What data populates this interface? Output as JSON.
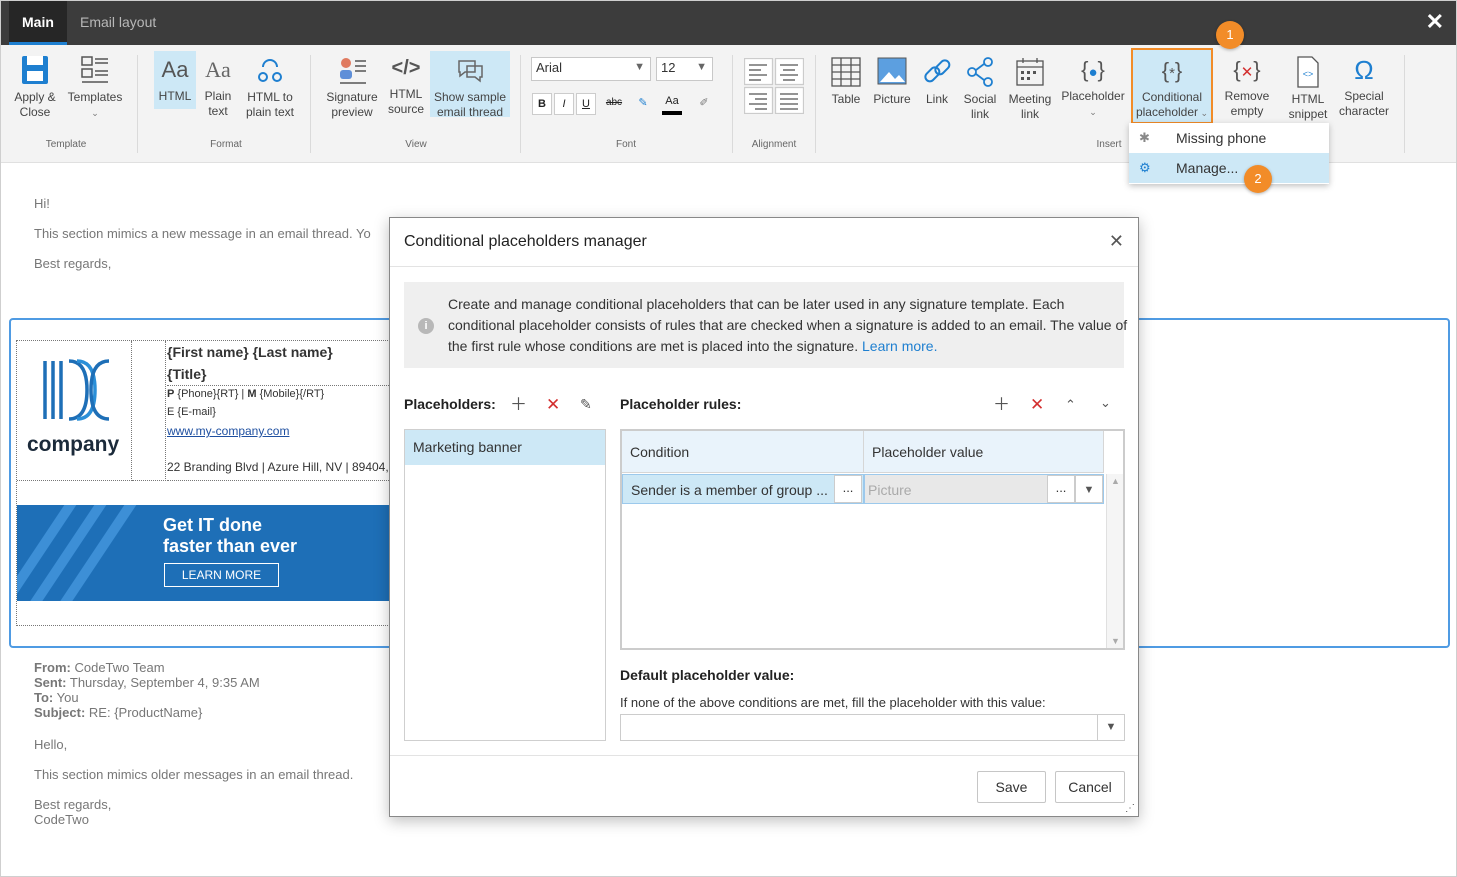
{
  "tabs": {
    "main": "Main",
    "email_layout": "Email layout"
  },
  "ribbon": {
    "template": {
      "apply_close": [
        "Apply &",
        "Close"
      ],
      "templates": "Templates",
      "group": "Template"
    },
    "format": {
      "html": "HTML",
      "plain": [
        "Plain",
        "text"
      ],
      "html_to_plain": [
        "HTML to",
        "plain text"
      ],
      "group": "Format"
    },
    "view": {
      "signature_preview": [
        "Signature",
        "preview"
      ],
      "html_source": [
        "HTML",
        "source"
      ],
      "show_sample": [
        "Show sample",
        "email thread"
      ],
      "group": "View"
    },
    "font": {
      "family": "Arial",
      "size": "12",
      "group": "Font",
      "bold": "B",
      "italic": "I",
      "underline": "U",
      "strike": "abc",
      "color": "Aa"
    },
    "alignment": {
      "group": "Alignment"
    },
    "insert": {
      "table": "Table",
      "picture": "Picture",
      "link": "Link",
      "social": [
        "Social",
        "link"
      ],
      "meeting": [
        "Meeting",
        "link"
      ],
      "placeholder": "Placeholder",
      "conditional": [
        "Conditional",
        "placeholder"
      ],
      "remove_empty": [
        "Remove",
        "empty"
      ],
      "html_snippet": [
        "HTML",
        "snippet"
      ],
      "special_char": [
        "Special",
        "character"
      ],
      "group": "Insert"
    }
  },
  "dropdown": {
    "items": [
      {
        "label": "Missing phone",
        "icon": "asterisk-icon"
      },
      {
        "label": "Manage...",
        "icon": "gear-icon"
      }
    ]
  },
  "callouts": [
    "1",
    "2"
  ],
  "email": {
    "greeting": "Hi!",
    "line1": "This section mimics a new message in an email thread. Yo",
    "regards": "Best regards,",
    "from_label": "From:",
    "from": "CodeTwo Team",
    "sent_label": "Sent:",
    "sent": "Thursday, September 4, 9:35 AM",
    "to_label": "To:",
    "to": "You",
    "subject_label": "Subject:",
    "subject": "RE: {ProductName}",
    "hello": "Hello,",
    "older": "This section mimics older messages in an email thread.",
    "regards2": "Best regards,",
    "sender": "CodeTwo"
  },
  "signature": {
    "company": "company",
    "name": "{First name} {Last name}",
    "title": "{Title}",
    "phone_label": "P",
    "phone": "{Phone}{RT}",
    "mobile_label": "M",
    "mobile": "{Mobile}{/RT}",
    "email_label": "E",
    "email": "{E-mail}",
    "website": "www.my-company.com",
    "address": "22 Branding Blvd | Azure Hill, NV | 89404,",
    "banner_line1": "Get IT done",
    "banner_line2": "faster than ever",
    "banner_button": "LEARN MORE"
  },
  "dialog": {
    "title": "Conditional placeholders manager",
    "info_text": "Create and manage conditional placeholders that can be later used in any signature template. Each conditional placeholder consists of rules that are checked when a signature is added to an email. The value of the first rule whose conditions are met is placed into the signature.",
    "learn_more": "Learn more.",
    "placeholders_label": "Placeholders:",
    "placeholders": [
      "Marketing banner"
    ],
    "rules_label": "Placeholder rules:",
    "columns": [
      "Condition",
      "Placeholder value"
    ],
    "rules": [
      {
        "condition": "Sender is a member of group ...",
        "value_placeholder": "Picture"
      }
    ],
    "ellipsis": "...",
    "default_label": "Default placeholder value:",
    "default_hint": "If none of the above conditions are met, fill the placeholder with this value:",
    "save": "Save",
    "cancel": "Cancel"
  },
  "colors": {
    "accent": "#1e7fd0",
    "callout": "#f28c28",
    "selection": "#cde8f6",
    "banner": "#1e6fb7",
    "delete": "#d32f2f"
  }
}
